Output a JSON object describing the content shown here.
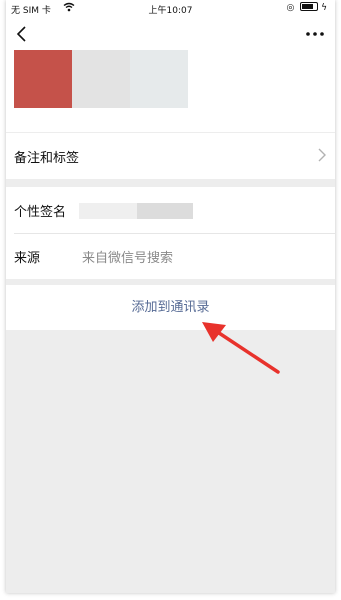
{
  "status_bar": {
    "carrier": "无 SIM 卡",
    "time": "上午10:07"
  },
  "profile": {
    "remark_tags_label": "备注和标签",
    "signature_label": "个性签名",
    "source_label": "来源",
    "source_value": "来自微信号搜索"
  },
  "actions": {
    "add_to_contacts": "添加到通讯录"
  },
  "colors": {
    "link": "#576b95",
    "annotation_arrow": "#e8322c",
    "avatar_red": "#c5524a"
  },
  "icons": [
    "back-arrow-icon",
    "more-icon",
    "chevron-right-icon",
    "wifi-icon",
    "lock-rotation-icon",
    "battery-icon",
    "charging-icon"
  ]
}
